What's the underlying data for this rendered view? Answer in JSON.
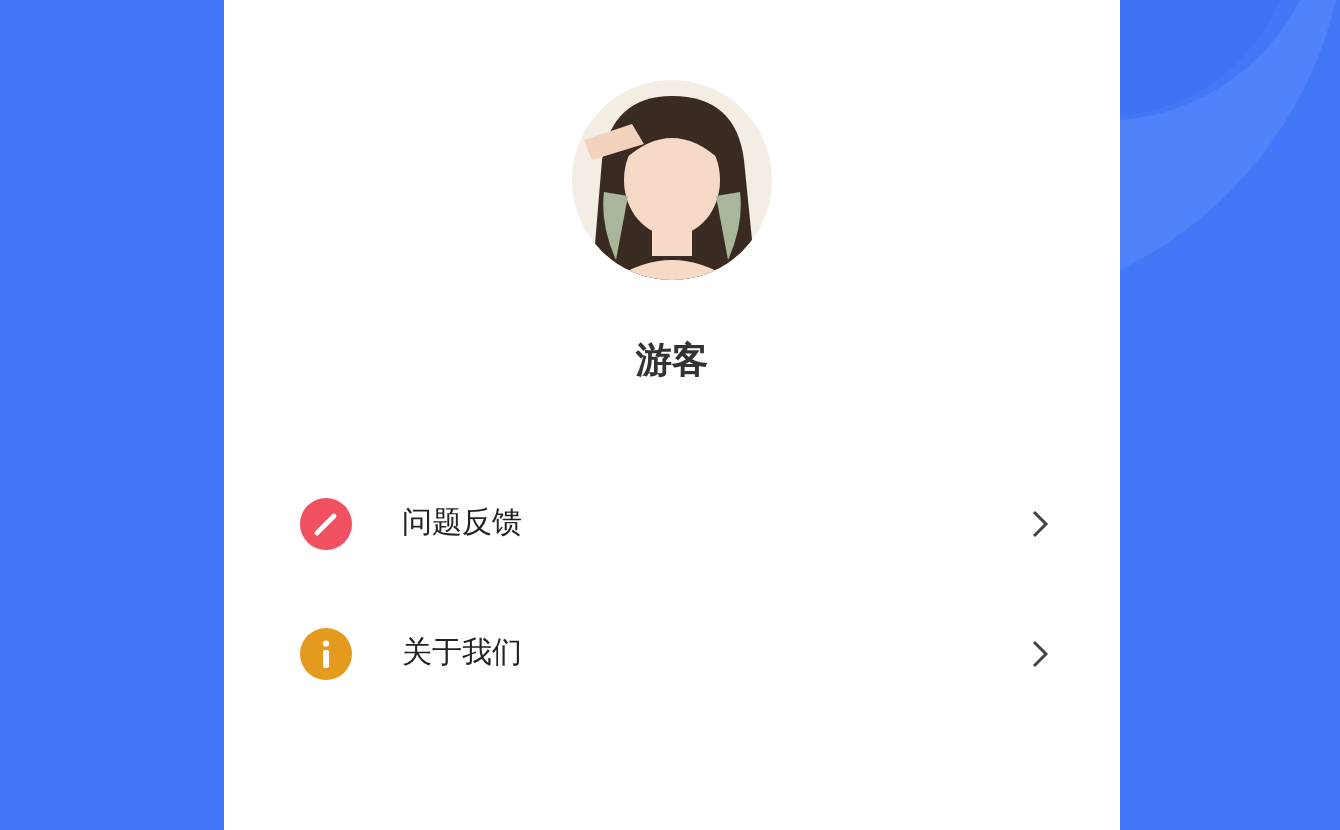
{
  "profile": {
    "name": "游客"
  },
  "menu": [
    {
      "kind": "pencil",
      "color": "#f0505f",
      "label": "问题反馈"
    },
    {
      "kind": "info",
      "color": "#e39a1d",
      "label": "关于我们"
    }
  ]
}
